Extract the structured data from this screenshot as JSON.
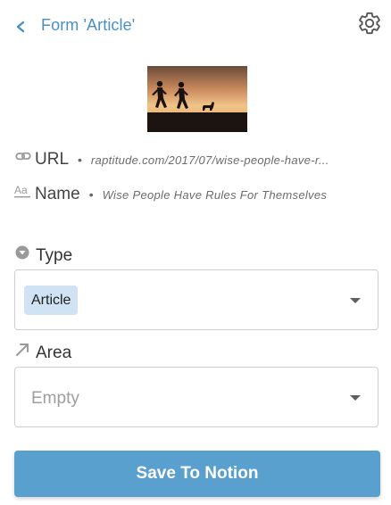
{
  "header": {
    "title": "Form 'Article'",
    "back_icon": "chevron-left-icon",
    "settings_icon": "gear-icon",
    "accent_color": "#4a90c2"
  },
  "thumbnail": {
    "description_icon": "image-thumbnail"
  },
  "properties": {
    "url": {
      "icon": "link-icon",
      "label": "URL",
      "value": "raptitude.com/2017/07/wise-people-have-r..."
    },
    "name": {
      "icon": "text-aa-icon",
      "label": "Name",
      "value": "Wise People Have Rules For Themselves"
    }
  },
  "fields": {
    "type": {
      "icon": "select-caret-circle-icon",
      "label": "Type",
      "selected": "Article",
      "chip_color": "#cfe3f5"
    },
    "area": {
      "icon": "relation-arrow-icon",
      "label": "Area",
      "placeholder": "Empty"
    }
  },
  "actions": {
    "save_label": "Save To Notion",
    "save_color": "#5aa0cf"
  }
}
